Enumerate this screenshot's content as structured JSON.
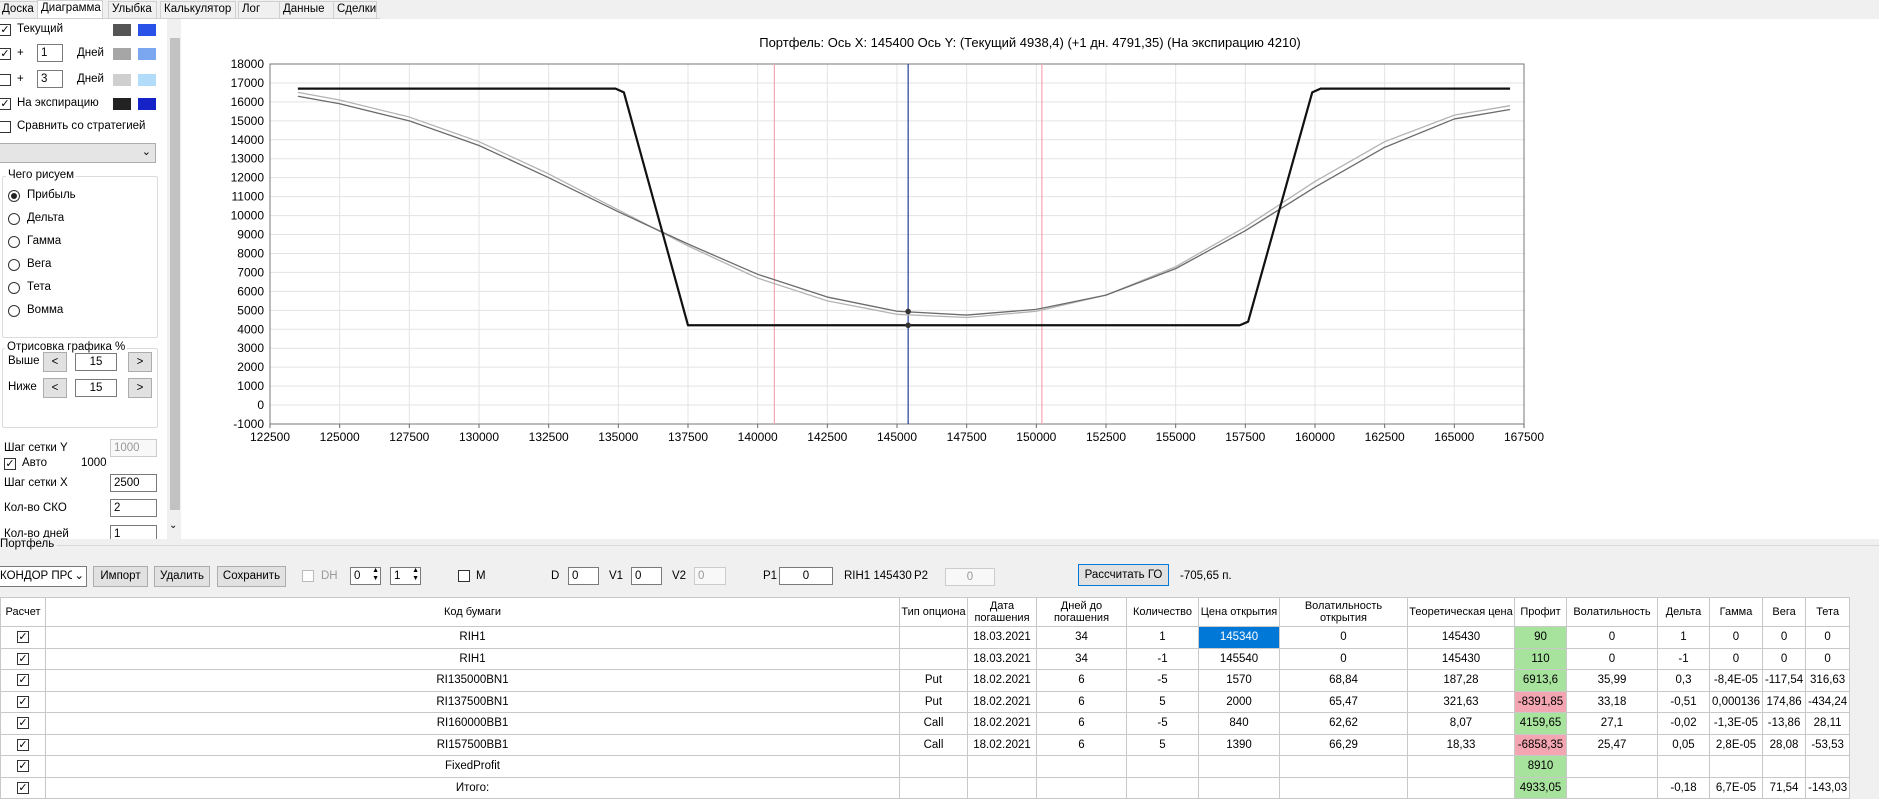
{
  "tabs": [
    "Доска",
    "Диаграмма",
    "Улыбка",
    "Калькулятор",
    "Лог",
    "Данные",
    "Сделки"
  ],
  "active_tab": 1,
  "left": {
    "rows": [
      {
        "checked": true,
        "label": "Текущий",
        "colors": [
          "#555555",
          "#2952e8"
        ]
      },
      {
        "checked": true,
        "prefix": "+",
        "days": "1",
        "unit": "Дней",
        "colors": [
          "#a6a6a6",
          "#7aa7f0"
        ]
      },
      {
        "checked": false,
        "prefix": "+",
        "days": "3",
        "unit": "Дней",
        "colors": [
          "#cfcfcf",
          "#b3dcfa"
        ]
      },
      {
        "checked": true,
        "label": "На экспирацию",
        "colors": [
          "#222222",
          "#1422c8"
        ]
      }
    ],
    "compare_label": "Сравнить со стратегией",
    "compare_checked": false,
    "what_group": "Чего рисуем",
    "radios": [
      "Прибыль",
      "Дельта",
      "Гамма",
      "Вега",
      "Тета",
      "Вомма"
    ],
    "radio_selected": 0,
    "render_group": "Отрисовка графика %",
    "above_label": "Выше",
    "above_value": "15",
    "below_label": "Ниже",
    "below_value": "15",
    "btn_left": "<",
    "btn_right": ">",
    "grid_y_label": "Шаг сетки Y",
    "grid_y_value": "1000",
    "auto_label": "Авто",
    "auto_checked": true,
    "auto_value": "1000",
    "grid_x_label": "Шаг сетки X",
    "grid_x_value": "2500",
    "sko_label": "Кол-во СКО",
    "sko_value": "2",
    "days_label": "Кол-во дней",
    "days_value": "1"
  },
  "chart_data": {
    "type": "line",
    "title": "Портфель: Ось X: 145400 Ось Y:  (Текущий 4938,4)  (+1 дн. 4791,35)  (На экспирацию 4210)",
    "xlim": [
      122500,
      167500
    ],
    "ylim": [
      -1000,
      18000
    ],
    "x_ticks": [
      122500,
      125000,
      127500,
      130000,
      132500,
      135000,
      137500,
      140000,
      142500,
      145000,
      147500,
      150000,
      152500,
      155000,
      157500,
      160000,
      162500,
      165000,
      167500
    ],
    "y_ticks": [
      -1000,
      0,
      1000,
      2000,
      3000,
      4000,
      5000,
      6000,
      7000,
      8000,
      9000,
      10000,
      11000,
      12000,
      13000,
      14000,
      15000,
      16000,
      17000,
      18000
    ],
    "grid": true,
    "vlines": [
      {
        "x": 140600,
        "color": "#f4a6b4"
      },
      {
        "x": 145400,
        "color": "#1f3f9a"
      },
      {
        "x": 150200,
        "color": "#f4a6b4"
      }
    ],
    "markers": [
      {
        "x": 145400,
        "y": 4938.4
      },
      {
        "x": 145400,
        "y": 4210
      }
    ],
    "series": [
      {
        "color": "#111111",
        "width": 2.2,
        "x": [
          123500,
          134900,
          135200,
          137500,
          157300,
          157600,
          159900,
          160200,
          167000
        ],
        "y": [
          16700,
          16700,
          16500,
          4210,
          4210,
          4400,
          16500,
          16700,
          16700
        ]
      },
      {
        "color": "#6b6b6b",
        "width": 1.3,
        "x": [
          123500,
          125000,
          127500,
          130000,
          132500,
          135000,
          137500,
          140000,
          142500,
          145000,
          147500,
          150000,
          152500,
          155000,
          157500,
          160000,
          162500,
          165000,
          167000
        ],
        "y": [
          16300,
          15900,
          15000,
          13700,
          12000,
          10200,
          8500,
          6900,
          5700,
          4950,
          4750,
          5050,
          5800,
          7200,
          9200,
          11500,
          13600,
          15100,
          15600
        ]
      },
      {
        "color": "#b3b3b3",
        "width": 1.3,
        "x": [
          123500,
          125000,
          127500,
          130000,
          132500,
          135000,
          137500,
          140000,
          142500,
          145000,
          147500,
          150000,
          152500,
          155000,
          157500,
          160000,
          162500,
          165000,
          167000
        ],
        "y": [
          16500,
          16100,
          15200,
          13900,
          12200,
          10300,
          8400,
          6700,
          5500,
          4790,
          4620,
          4950,
          5800,
          7300,
          9400,
          11800,
          13900,
          15300,
          15800
        ]
      }
    ]
  },
  "portfolio": {
    "title": "Портфель",
    "combo": "КОНДОР ПРО",
    "import": "Импорт",
    "delete": "Удалить",
    "save": "Сохранить",
    "dh": "DH",
    "spin1": "0",
    "spin2": "1",
    "m": "M",
    "d_label": "D",
    "d_value": "0",
    "v1_label": "V1",
    "v1_value": "0",
    "v2_label": "V2",
    "v2_value": "0",
    "p1_label": "P1",
    "p1_value": "0",
    "ticker_info": "RIH1 145430",
    "p2_label": "P2",
    "p2_value": "0",
    "calc_go": "Рассчитать ГО",
    "go_value": "-705,65 п."
  },
  "table": {
    "headers": [
      "Расчет",
      "Код бумаги",
      "Тип опциона",
      "Дата погашения",
      "Дней до погашения",
      "Количество",
      "Цена открытия",
      "Волатильность открытия",
      "Теоретическая цена",
      "Профит",
      "Волатильность",
      "Дельта",
      "Гамма",
      "Вега",
      "Тета"
    ],
    "rows": [
      {
        "code": "RIH1",
        "type": "",
        "date": "18.03.2021",
        "days": "34",
        "qty": "1",
        "open": "145340",
        "vol_open": "0",
        "theo": "145430",
        "profit": "90",
        "vol": "0",
        "delta": "1",
        "gamma": "0",
        "vega": "0",
        "theta": "0",
        "profit_color": "#a8e39e",
        "open_sel": true
      },
      {
        "code": "RIH1",
        "type": "",
        "date": "18.03.2021",
        "days": "34",
        "qty": "-1",
        "open": "145540",
        "vol_open": "0",
        "theo": "145430",
        "profit": "110",
        "vol": "0",
        "delta": "-1",
        "gamma": "0",
        "vega": "0",
        "theta": "0",
        "profit_color": "#a8e39e"
      },
      {
        "code": "RI135000BN1",
        "type": "Put",
        "date": "18.02.2021",
        "days": "6",
        "qty": "-5",
        "open": "1570",
        "vol_open": "68,84",
        "theo": "187,28",
        "profit": "6913,6",
        "vol": "35,99",
        "delta": "0,3",
        "gamma": "-8,4E-05",
        "vega": "-117,54",
        "theta": "316,63",
        "profit_color": "#a8e39e"
      },
      {
        "code": "RI137500BN1",
        "type": "Put",
        "date": "18.02.2021",
        "days": "6",
        "qty": "5",
        "open": "2000",
        "vol_open": "65,47",
        "theo": "321,63",
        "profit": "-8391,85",
        "vol": "33,18",
        "delta": "-0,51",
        "gamma": "0,000136",
        "vega": "174,86",
        "theta": "-434,24",
        "profit_color": "#f3a6b1"
      },
      {
        "code": "RI160000BB1",
        "type": "Call",
        "date": "18.02.2021",
        "days": "6",
        "qty": "-5",
        "open": "840",
        "vol_open": "62,62",
        "theo": "8,07",
        "profit": "4159,65",
        "vol": "27,1",
        "delta": "-0,02",
        "gamma": "-1,3E-05",
        "vega": "-13,86",
        "theta": "28,11",
        "profit_color": "#a8e39e"
      },
      {
        "code": "RI157500BB1",
        "type": "Call",
        "date": "18.02.2021",
        "days": "6",
        "qty": "5",
        "open": "1390",
        "vol_open": "66,29",
        "theo": "18,33",
        "profit": "-6858,35",
        "vol": "25,47",
        "delta": "0,05",
        "gamma": "2,8E-05",
        "vega": "28,08",
        "theta": "-53,53",
        "profit_color": "#f3a6b1"
      },
      {
        "code": "FixedProfit",
        "type": "",
        "date": "",
        "days": "",
        "qty": "",
        "open": "",
        "vol_open": "",
        "theo": "",
        "profit": "8910",
        "vol": "",
        "delta": "",
        "gamma": "",
        "vega": "",
        "theta": "",
        "profit_color": "#a8e39e"
      },
      {
        "code": "Итого:",
        "type": "",
        "date": "",
        "days": "",
        "qty": "",
        "open": "",
        "vol_open": "",
        "theo": "",
        "profit": "4933,05",
        "vol": "",
        "delta": "-0,18",
        "gamma": "6,7E-05",
        "vega": "71,54",
        "theta": "-143,03",
        "profit_color": "#a8e39e"
      }
    ]
  }
}
